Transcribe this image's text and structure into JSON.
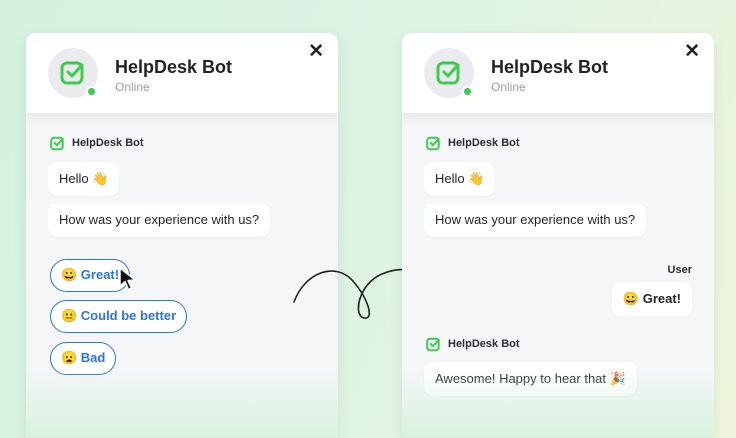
{
  "colors": {
    "accent": "#2b74d9",
    "brand_green": "#3ecb4f",
    "status_online": "#3ecb4f"
  },
  "icons": {
    "bot_logo": "checkbox-check-icon",
    "close": "close-icon",
    "cursor": "mouse-pointer-icon",
    "flow_arrow": "curved-arrow-icon"
  },
  "left_panel": {
    "header": {
      "title": "HelpDesk Bot",
      "status": "Online",
      "close_label": "✕"
    },
    "messages": {
      "sender": "HelpDesk Bot",
      "greeting": "Hello 👋",
      "question": "How was your experience with us?"
    },
    "options": [
      "😀 Great!",
      "😐 Could be better",
      "😦 Bad"
    ]
  },
  "right_panel": {
    "header": {
      "title": "HelpDesk Bot",
      "status": "Online",
      "close_label": "✕"
    },
    "messages": {
      "sender": "HelpDesk Bot",
      "greeting": "Hello 👋",
      "question": "How was your experience with us?",
      "user_label": "User",
      "user_reply": "😀 Great!",
      "bot_reply_sender": "HelpDesk Bot",
      "bot_reply": "Awesome! Happy to hear that 🎉"
    }
  }
}
